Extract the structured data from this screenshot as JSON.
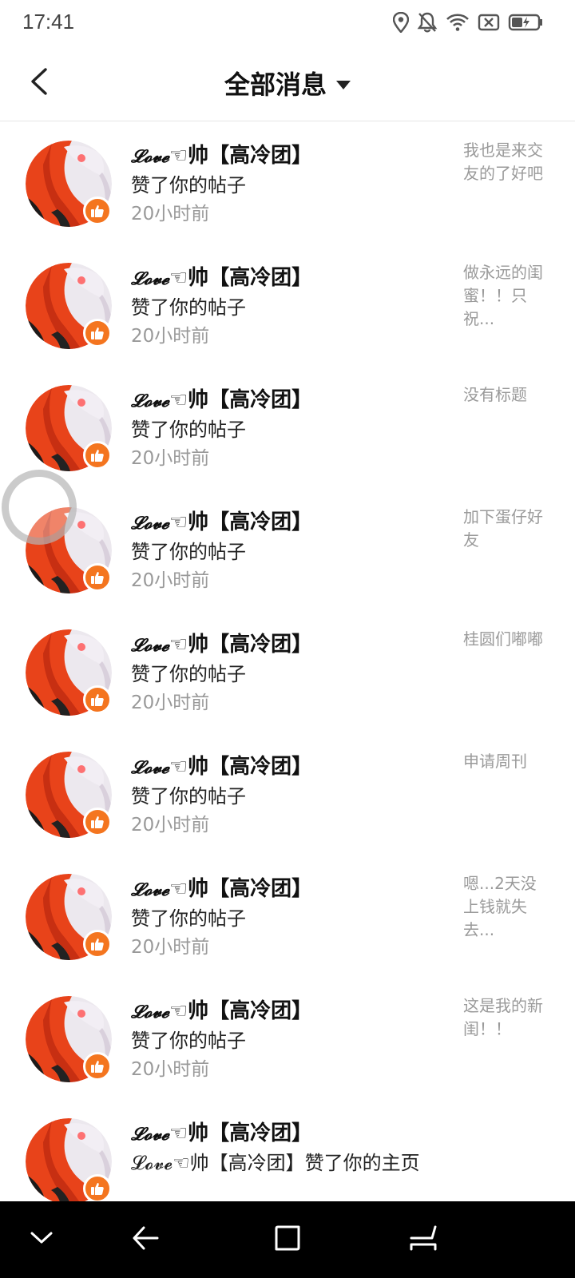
{
  "status_bar": {
    "time": "17:41",
    "icons": [
      "location-icon",
      "bell-off-icon",
      "wifi-icon",
      "no-sim-icon",
      "battery-charging-icon"
    ]
  },
  "header": {
    "title": "全部消息",
    "back_icon": "back-arrow-icon",
    "dropdown_icon": "caret-down-icon"
  },
  "messages": [
    {
      "name_love": "𝓛𝓸𝓿𝓮",
      "name_rest": "☜帅【高冷团】",
      "action": "赞了你的帖子",
      "time": "20小时前",
      "preview": "我也是来交友的了好吧",
      "badge_icon": "thumbs-up-icon"
    },
    {
      "name_love": "𝓛𝓸𝓿𝓮",
      "name_rest": "☜帅【高冷团】",
      "action": "赞了你的帖子",
      "time": "20小时前",
      "preview": "做永远的闺蜜！！只祝...",
      "badge_icon": "thumbs-up-icon"
    },
    {
      "name_love": "𝓛𝓸𝓿𝓮",
      "name_rest": "☜帅【高冷团】",
      "action": "赞了你的帖子",
      "time": "20小时前",
      "preview": "没有标题",
      "badge_icon": "thumbs-up-icon"
    },
    {
      "name_love": "𝓛𝓸𝓿𝓮",
      "name_rest": "☜帅【高冷团】",
      "action": "赞了你的帖子",
      "time": "20小时前",
      "preview": "加下蛋仔好友",
      "badge_icon": "thumbs-up-icon"
    },
    {
      "name_love": "𝓛𝓸𝓿𝓮",
      "name_rest": "☜帅【高冷团】",
      "action": "赞了你的帖子",
      "time": "20小时前",
      "preview": "桂圆们嘟嘟",
      "badge_icon": "thumbs-up-icon"
    },
    {
      "name_love": "𝓛𝓸𝓿𝓮",
      "name_rest": "☜帅【高冷团】",
      "action": "赞了你的帖子",
      "time": "20小时前",
      "preview": "申请周刊",
      "badge_icon": "thumbs-up-icon"
    },
    {
      "name_love": "𝓛𝓸𝓿𝓮",
      "name_rest": "☜帅【高冷团】",
      "action": "赞了你的帖子",
      "time": "20小时前",
      "preview": "嗯...2天没上钱就失去...",
      "badge_icon": "thumbs-up-icon"
    },
    {
      "name_love": "𝓛𝓸𝓿𝓮",
      "name_rest": "☜帅【高冷团】",
      "action": "赞了你的帖子",
      "time": "20小时前",
      "preview": "这是我的新闺！！",
      "badge_icon": "thumbs-up-icon"
    },
    {
      "name_love": "𝓛𝓸𝓿𝓮",
      "name_rest": "☜帅【高冷团】",
      "action": "𝓛𝓸𝓿𝓮☜帅【高冷团】赞了你的主页",
      "time": "",
      "preview": "",
      "badge_icon": "thumbs-up-icon"
    }
  ],
  "nav_bar": {
    "icons": [
      "hide-keyboard-icon",
      "back-icon",
      "home-icon",
      "recents-icon"
    ]
  },
  "colors": {
    "accent_orange": "#f4751f",
    "avatar_red": "#e8431a",
    "nav_background": "#000000"
  }
}
